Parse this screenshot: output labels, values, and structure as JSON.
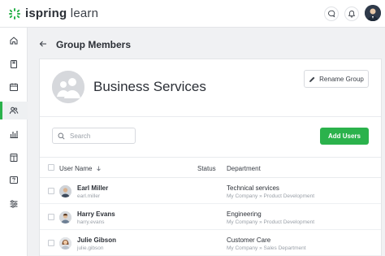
{
  "brand": {
    "logo_text_prefix": "ispring",
    "logo_text_suffix": "learn",
    "accent": "#2bb24c"
  },
  "topbar": {
    "icons": [
      "chat-icon",
      "bell-icon",
      "user-avatar"
    ]
  },
  "sidebar": {
    "items": [
      {
        "icon": "home-icon",
        "active": false
      },
      {
        "icon": "book-icon",
        "active": false
      },
      {
        "icon": "calendar-icon",
        "active": false
      },
      {
        "icon": "users-icon",
        "active": true
      },
      {
        "icon": "chart-icon",
        "active": false
      },
      {
        "icon": "document-icon",
        "active": false
      },
      {
        "icon": "question-icon",
        "active": false
      },
      {
        "icon": "settings-sliders-icon",
        "active": false
      }
    ]
  },
  "page": {
    "title": "Group Members"
  },
  "group": {
    "name": "Business Services",
    "rename_label": "Rename Group"
  },
  "search": {
    "placeholder": "Search"
  },
  "add_users_label": "Add Users",
  "table": {
    "columns": {
      "name": "User Name",
      "status": "Status",
      "department": "Department"
    },
    "rows": [
      {
        "name": "Earl Miller",
        "login": "earl.miller",
        "status": "",
        "department": "Technical services",
        "path": "My Company » Product Development"
      },
      {
        "name": "Harry Evans",
        "login": "harry.evans",
        "status": "",
        "department": "Engineering",
        "path": "My Company » Product Development"
      },
      {
        "name": "Julie Gibson",
        "login": "julie.gibson",
        "status": "",
        "department": "Customer Care",
        "path": "My Company » Sales Department"
      }
    ]
  }
}
